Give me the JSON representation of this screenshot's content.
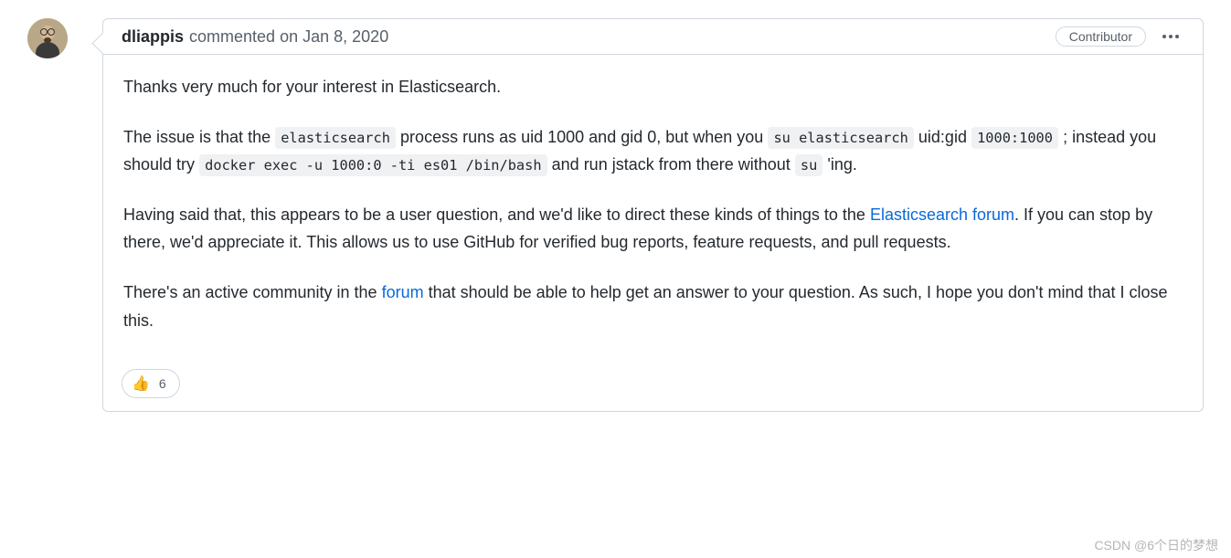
{
  "comment": {
    "author": "dliappis",
    "action": "commented",
    "on_word": "on",
    "date": "Jan 8, 2020",
    "badge": "Contributor",
    "body": {
      "p1": "Thanks very much for your interest in Elasticsearch.",
      "p2_a": "The issue is that the ",
      "p2_code1": "elasticsearch",
      "p2_b": " process runs as uid 1000 and gid 0, but when you ",
      "p2_code2": "su elasticsearch",
      "p2_c": " uid:gid ",
      "p2_code3": "1000:1000",
      "p2_d": " ; instead you should try ",
      "p2_code4": "docker exec -u 1000:0 -ti es01 /bin/bash",
      "p2_e": " and run jstack from there without ",
      "p2_code5": "su",
      "p2_f": " 'ing.",
      "p3_a": "Having said that, this appears to be a user question, and we'd like to direct these kinds of things to the ",
      "p3_link1": "Elasticsearch forum",
      "p3_b": ". If you can stop by there, we'd appreciate it. This allows us to use GitHub for verified bug reports, feature requests, and pull requests.",
      "p4_a": "There's an active community in the ",
      "p4_link1": "forum",
      "p4_b": " that should be able to help get an answer to your question. As such, I hope you don't mind that I close this."
    },
    "reaction": {
      "emoji": "👍",
      "count": "6"
    }
  },
  "watermark": "CSDN @6个日的梦想"
}
